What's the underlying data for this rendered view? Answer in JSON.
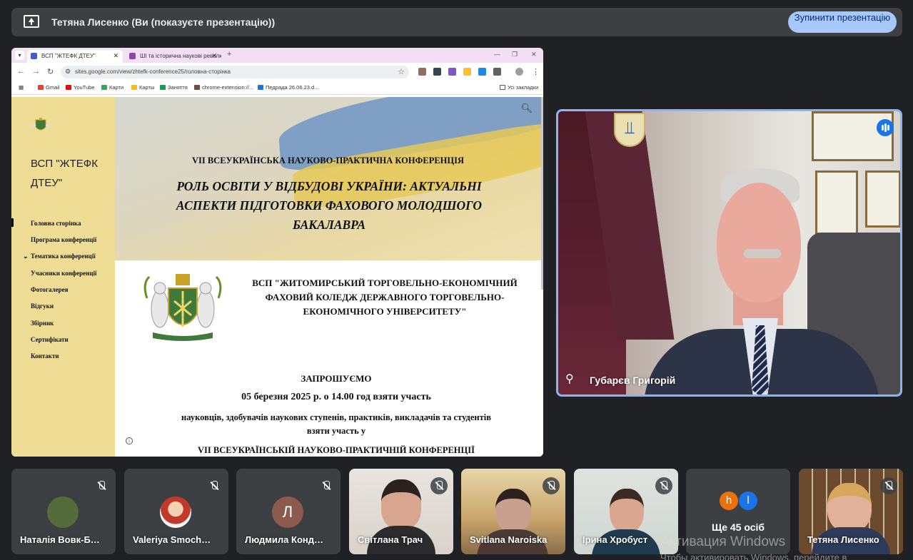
{
  "presenting_bar": {
    "text": "Тетяна Лисенко (Ви (показуєте презентацію))",
    "stop_button": "Зупинити презентацію"
  },
  "browser": {
    "tabs": [
      {
        "title": "ВСП \"ЖТЕФК ДТЕУ\"",
        "active": true
      },
      {
        "title": "ШІ та історична наукові революції",
        "active": false
      }
    ],
    "url": "sites.google.com/view/zhtefk-conference25/головна-сторінка",
    "bookmarks": [
      "Gmail",
      "YouTube",
      "Карти",
      "Карты",
      "Заняття",
      "chrome-extension://...",
      "Педрада 26.06.23.d..."
    ],
    "all_bookmarks": "Усі закладки"
  },
  "site": {
    "title": "ВСП \"ЖТЕФК ДТЕУ\"",
    "nav": [
      "Головна сторінка",
      "Програма конференції",
      "Тематика конференції",
      "Учасники конференції",
      "Фотогалерея",
      "Відгуки",
      "Збірник",
      "Сертифікати",
      "Контакти"
    ],
    "hero_subtitle": "VII ВСЕУКРАЇНСЬКА  НАУКОВО-ПРАКТИЧНА КОНФЕРЕНЦІЯ",
    "hero_title": "РОЛЬ ОСВІТИ У ВІДБУДОВІ УКРАЇНИ: АКТУАЛЬНІ АСПЕКТИ  ПІДГОТОВКИ ФАХОВОГО МОЛОДШОГО БАКАЛАВРА",
    "college_name": "ВСП \"ЖИТОМИРСЬКИЙ ТОРГОВЕЛЬНО-ЕКОНОМІЧНИЙ ФАХОВИЙ КОЛЕДЖ ДЕРЖАВНОГО ТОРГОВЕЛЬНО-ЕКОНОМІЧНОГО УНІВЕРСИТЕТУ\"",
    "invite_heading": "ЗАПРОШУЄМО",
    "invite_date": "05 березня 2025 р.  о 14.00 год взяти участь",
    "invite_line1": "науковців, здобувачів наукових ступенів, практиків, викладачів та студентів",
    "invite_line2": "взяти участь у",
    "invite_line3": "VII ВСЕУКРАЇНСЬКІЙ  НАУКОВО-ПРАКТИЧНІЙ КОНФЕРЕНЦІЇ"
  },
  "speaker": {
    "name": "Губарєв Григорій"
  },
  "participants": [
    {
      "name": "Наталія Вовк-Б…",
      "type": "photo-avatar",
      "color": "#556b3a"
    },
    {
      "name": "Valeriya Smoch…",
      "type": "photo-avatar",
      "color": "#c0392b"
    },
    {
      "name": "Людмила Конд…",
      "type": "letter-avatar",
      "letter": "Л",
      "color": "#8d5a4e"
    },
    {
      "name": "Світлана Трач",
      "type": "video"
    },
    {
      "name": "Svitlana Naroiska",
      "type": "video"
    },
    {
      "name": "Ірина Хробуст",
      "type": "video"
    },
    {
      "name": "Ще 45 осіб",
      "type": "more",
      "mini": [
        "h",
        "l"
      ]
    },
    {
      "name": "Тетяна Лисенко",
      "type": "video"
    }
  ],
  "watermark": {
    "line1": "Активация Windows",
    "line2": "Чтобы активировать Windows, перейдите в"
  }
}
